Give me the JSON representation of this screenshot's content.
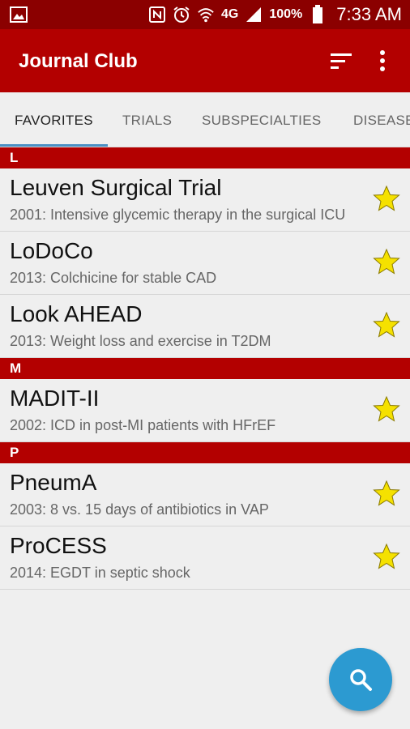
{
  "status_bar": {
    "battery": "100%",
    "network": "4G",
    "time": "7:33 AM"
  },
  "app_bar": {
    "title": "Journal Club"
  },
  "tabs": [
    {
      "label": "FAVORITES",
      "active": true
    },
    {
      "label": "TRIALS",
      "active": false
    },
    {
      "label": "SUBSPECIALTIES",
      "active": false
    },
    {
      "label": "DISEASES",
      "active": false
    }
  ],
  "sections": [
    {
      "letter": "L",
      "items": [
        {
          "title": "Leuven Surgical Trial",
          "subtitle": "2001: Intensive glycemic therapy in the surgical ICU"
        },
        {
          "title": "LoDoCo",
          "subtitle": "2013: Colchicine for stable CAD"
        },
        {
          "title": "Look AHEAD",
          "subtitle": "2013: Weight loss and exercise in T2DM"
        }
      ]
    },
    {
      "letter": "M",
      "items": [
        {
          "title": "MADIT-II",
          "subtitle": "2002: ICD in post-MI patients with HFrEF"
        }
      ]
    },
    {
      "letter": "P",
      "items": [
        {
          "title": "PneumA",
          "subtitle": "2003: 8 vs. 15 days of antibiotics in VAP"
        },
        {
          "title": "ProCESS",
          "subtitle": "2014: EGDT in septic shock"
        }
      ]
    }
  ],
  "colors": {
    "primary": "#b30000",
    "status_bar": "#8b0000",
    "accent": "#2c9ad1",
    "star": "#f5e100"
  },
  "icons": {
    "sort": "sort-icon",
    "more": "more-vert-icon",
    "star": "star-icon",
    "search": "search-icon"
  }
}
